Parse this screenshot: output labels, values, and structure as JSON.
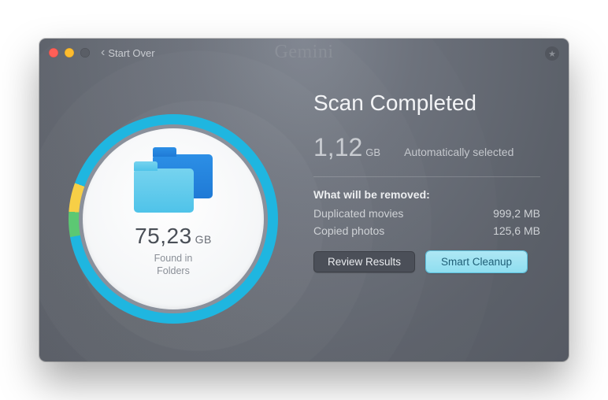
{
  "titlebar": {
    "back_label": "Start Over",
    "app_name": "Gemini"
  },
  "scan": {
    "size_value": "75,23",
    "size_unit": "GB",
    "found_line1": "Found in",
    "found_line2": "Folders"
  },
  "results": {
    "heading": "Scan Completed",
    "selected_size_value": "1,12",
    "selected_size_unit": "GB",
    "selected_label": "Automatically selected",
    "remove_heading": "What will be removed:",
    "items": [
      {
        "label": "Duplicated movies",
        "size": "999,2 MB"
      },
      {
        "label": "Copied photos",
        "size": "125,6 MB"
      }
    ]
  },
  "buttons": {
    "review": "Review Results",
    "cleanup": "Smart Cleanup"
  }
}
